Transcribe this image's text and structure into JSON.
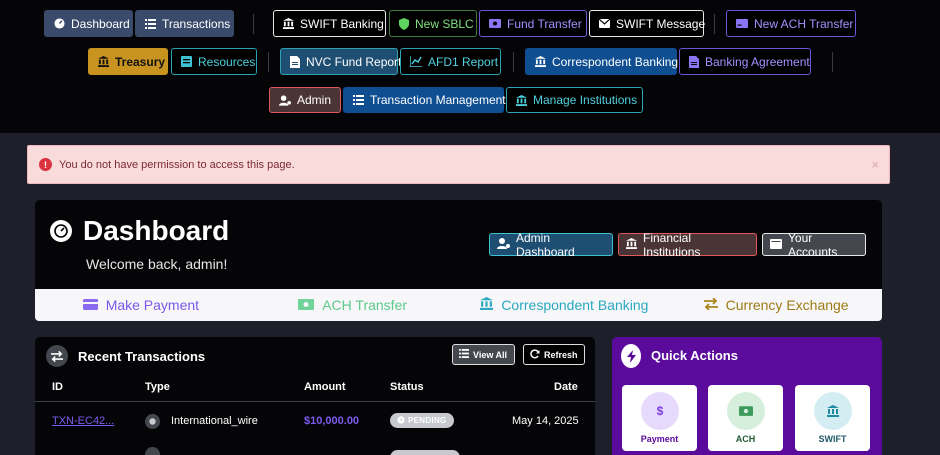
{
  "nav": {
    "row1": {
      "dashboard": "Dashboard",
      "transactions": "Transactions",
      "swift_banking": "SWIFT Banking",
      "new_sblc": "New SBLC",
      "fund_transfer": "Fund Transfer",
      "swift_message": "SWIFT Message",
      "new_ach_transfer": "New ACH Transfer"
    },
    "row2": {
      "treasury": "Treasury",
      "resources": "Resources",
      "nvc_fund_report": "NVC Fund Report",
      "afd1_report": "AFD1 Report",
      "correspondent_banking": "Correspondent Banking",
      "banking_agreement": "Banking Agreement"
    },
    "row3": {
      "admin": "Admin",
      "transaction_management": "Transaction Management",
      "manage_institutions": "Manage Institutions"
    }
  },
  "alert": {
    "message": "You do not have permission to access this page.",
    "close": "×"
  },
  "dashboard": {
    "title": "Dashboard",
    "welcome": "Welcome back, admin!",
    "admin_dashboard": "Admin Dashboard",
    "financial_institutions": "Financial Institutions",
    "your_accounts": "Your Accounts"
  },
  "quick_tabs": {
    "make_payment": "Make Payment",
    "ach_transfer": "ACH Transfer",
    "correspondent_banking": "Correspondent Banking",
    "currency_exchange": "Currency Exchange"
  },
  "recent": {
    "title": "Recent Transactions",
    "view_all": "View All",
    "refresh": "Refresh",
    "columns": {
      "id": "ID",
      "type": "Type",
      "amount": "Amount",
      "status": "Status",
      "date": "Date"
    },
    "rows": [
      {
        "id": "TXN-EC42...",
        "type": "International_wire",
        "amount": "$10,000.00",
        "status": "PENDING",
        "date": "May 14, 2025"
      }
    ]
  },
  "quick_actions": {
    "title": "Quick Actions",
    "payment": "Payment",
    "ach": "ACH",
    "swift": "SWIFT",
    "payment_symbol": "$"
  },
  "colors": {
    "nav_dark_blue": "#0e4e91",
    "nav_slate": "#3a4a6a",
    "treasury_gold": "#c99320",
    "admin_brown": "#4a3436",
    "quick_actions_purple": "#5b0b9b",
    "amount_purple": "#7c5cf0",
    "alert_bg": "#fadbdc"
  }
}
